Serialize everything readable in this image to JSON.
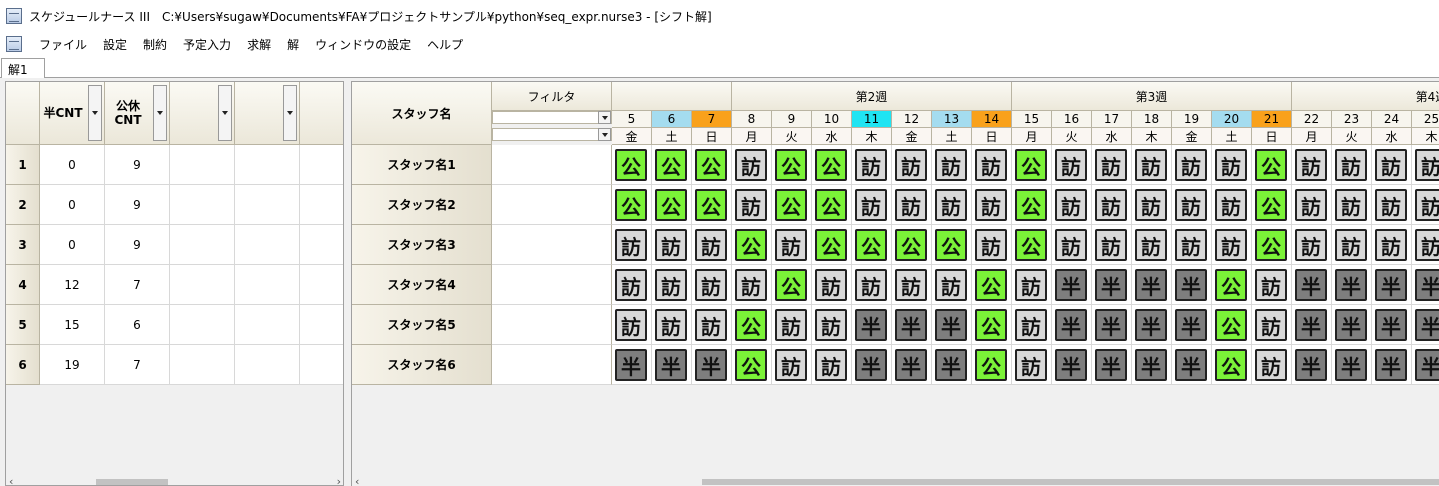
{
  "window": {
    "title": "スケジュールナース III　C:¥Users¥sugaw¥Documents¥FA¥プロジェクトサンプル¥python¥seq_expr.nurse3 - [シフト解]"
  },
  "menu": [
    "ファイル",
    "設定",
    "制約",
    "予定入力",
    "求解",
    "解",
    "ウィンドウの設定",
    "ヘルプ"
  ],
  "tab": {
    "label": "解1"
  },
  "left_table": {
    "headers": [
      "半CNT",
      "公休\nCNT",
      "",
      ""
    ],
    "rows": [
      {
        "id": "1",
        "han": "0",
        "kokyu": "9"
      },
      {
        "id": "2",
        "han": "0",
        "kokyu": "9"
      },
      {
        "id": "3",
        "han": "0",
        "kokyu": "9"
      },
      {
        "id": "4",
        "han": "12",
        "kokyu": "7"
      },
      {
        "id": "5",
        "han": "15",
        "kokyu": "6"
      },
      {
        "id": "6",
        "han": "19",
        "kokyu": "7"
      }
    ]
  },
  "schedule": {
    "staff_header": "スタッフ名",
    "filter_header": "フィルタ",
    "weeks": [
      {
        "label": "",
        "days": 3
      },
      {
        "label": "第2週",
        "days": 7
      },
      {
        "label": "第3週",
        "days": 7
      },
      {
        "label": "第4週",
        "days": 7
      }
    ],
    "days": [
      {
        "d": "5",
        "w": "金",
        "color": "#f7f5ee"
      },
      {
        "d": "6",
        "w": "土",
        "color": "#a4dcef"
      },
      {
        "d": "7",
        "w": "日",
        "color": "#f9a11b"
      },
      {
        "d": "8",
        "w": "月",
        "color": "#f7f5ee"
      },
      {
        "d": "9",
        "w": "火",
        "color": "#f7f5ee"
      },
      {
        "d": "10",
        "w": "水",
        "color": "#f7f5ee"
      },
      {
        "d": "11",
        "w": "木",
        "color": "#1fe4f2"
      },
      {
        "d": "12",
        "w": "金",
        "color": "#f7f5ee"
      },
      {
        "d": "13",
        "w": "土",
        "color": "#a4dcef"
      },
      {
        "d": "14",
        "w": "日",
        "color": "#f9a11b"
      },
      {
        "d": "15",
        "w": "月",
        "color": "#f7f5ee"
      },
      {
        "d": "16",
        "w": "火",
        "color": "#f7f5ee"
      },
      {
        "d": "17",
        "w": "水",
        "color": "#f7f5ee"
      },
      {
        "d": "18",
        "w": "木",
        "color": "#f7f5ee"
      },
      {
        "d": "19",
        "w": "金",
        "color": "#f7f5ee"
      },
      {
        "d": "20",
        "w": "土",
        "color": "#a4dcef"
      },
      {
        "d": "21",
        "w": "日",
        "color": "#f9a11b"
      },
      {
        "d": "22",
        "w": "月",
        "color": "#f7f5ee"
      },
      {
        "d": "23",
        "w": "火",
        "color": "#f7f5ee"
      },
      {
        "d": "24",
        "w": "水",
        "color": "#f7f5ee"
      },
      {
        "d": "25",
        "w": "木",
        "color": "#f7f5ee"
      }
    ],
    "staff": [
      {
        "name": "スタッフ名1",
        "shifts": [
          "公",
          "公",
          "公",
          "訪",
          "公",
          "公",
          "訪",
          "訪",
          "訪",
          "訪",
          "公",
          "訪",
          "訪",
          "訪",
          "訪",
          "訪",
          "公",
          "訪",
          "訪",
          "訪",
          "訪"
        ]
      },
      {
        "name": "スタッフ名2",
        "shifts": [
          "公",
          "公",
          "公",
          "訪",
          "公",
          "公",
          "訪",
          "訪",
          "訪",
          "訪",
          "公",
          "訪",
          "訪",
          "訪",
          "訪",
          "訪",
          "公",
          "訪",
          "訪",
          "訪",
          "訪"
        ]
      },
      {
        "name": "スタッフ名3",
        "shifts": [
          "訪",
          "訪",
          "訪",
          "公",
          "訪",
          "公",
          "公",
          "公",
          "公",
          "訪",
          "公",
          "訪",
          "訪",
          "訪",
          "訪",
          "訪",
          "公",
          "訪",
          "訪",
          "訪",
          "訪"
        ]
      },
      {
        "name": "スタッフ名4",
        "shifts": [
          "訪",
          "訪",
          "訪",
          "訪",
          "公",
          "訪",
          "訪",
          "訪",
          "訪",
          "公",
          "訪",
          "半",
          "半",
          "半",
          "半",
          "公",
          "訪",
          "半",
          "半",
          "半",
          "半"
        ]
      },
      {
        "name": "スタッフ名5",
        "shifts": [
          "訪",
          "訪",
          "訪",
          "公",
          "訪",
          "訪",
          "半",
          "半",
          "半",
          "公",
          "訪",
          "半",
          "半",
          "半",
          "半",
          "公",
          "訪",
          "半",
          "半",
          "半",
          "半"
        ]
      },
      {
        "name": "スタッフ名6",
        "shifts": [
          "半",
          "半",
          "半",
          "公",
          "訪",
          "訪",
          "半",
          "半",
          "半",
          "公",
          "訪",
          "半",
          "半",
          "半",
          "半",
          "公",
          "訪",
          "半",
          "半",
          "半",
          "半"
        ]
      }
    ],
    "shift_colors": {
      "公": "#7bf238",
      "訪": "#d8d8d8",
      "半": "#7e7e7e"
    }
  }
}
